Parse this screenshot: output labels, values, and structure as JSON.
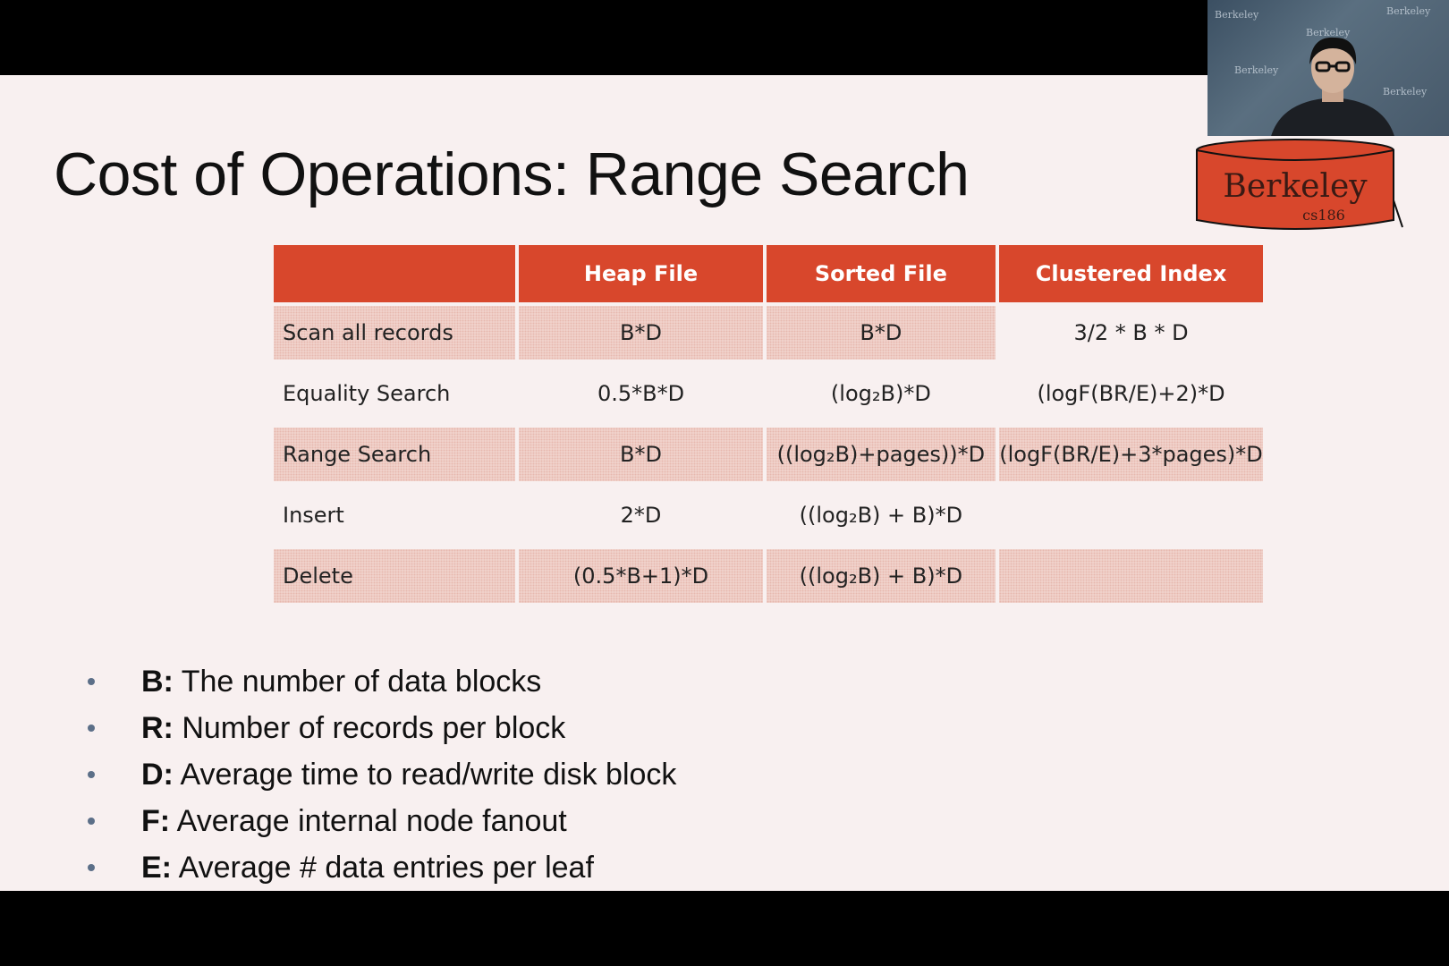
{
  "slide": {
    "title": "Cost of Operations: Range Search",
    "logo": {
      "text": "Berkeley",
      "subtext": "cs186",
      "color": "#d8472c"
    },
    "table": {
      "headers": [
        "",
        "Heap File",
        "Sorted File",
        "Clustered Index"
      ],
      "rows": [
        {
          "label": "Scan all records",
          "heap": "B*D",
          "sorted": "B*D",
          "clustered": "3/2 * B * D",
          "shaded": true
        },
        {
          "label": "Equality Search",
          "heap": "0.5*B*D",
          "sorted": "(log₂B)*D",
          "clustered": "(logF(BR/E)+2)*D",
          "shaded": false
        },
        {
          "label": "Range Search",
          "heap": "B*D",
          "sorted": "((log₂B)+pages))*D",
          "clustered": "(logF(BR/E)+3*pages)*D",
          "shaded": true
        },
        {
          "label": "Insert",
          "heap": "2*D",
          "sorted": "((log₂B) + B)*D",
          "clustered": "",
          "shaded": false
        },
        {
          "label": "Delete",
          "heap": "(0.5*B+1)*D",
          "sorted": "((log₂B) + B)*D",
          "clustered": "",
          "shaded": true
        }
      ]
    },
    "bullets": [
      {
        "key": "B:",
        "text": " The number of data blocks"
      },
      {
        "key": "R:",
        "text": " Number of records per block"
      },
      {
        "key": "D:",
        "text": " Average time to read/write disk block"
      },
      {
        "key": "F:",
        "text": " Average internal node fanout"
      },
      {
        "key": "E:",
        "text": " Average # data entries per leaf"
      }
    ]
  },
  "webcam": {
    "background_text": "Berkeley"
  },
  "colors": {
    "accent": "#d8472c",
    "slide_bg": "#f8f0f0",
    "shade": "#f2d6d0",
    "bullet": "#5c6f88"
  }
}
